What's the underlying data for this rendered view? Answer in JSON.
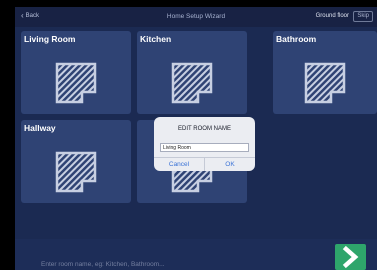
{
  "nav": {
    "back_label": "Back",
    "title": "Home Setup Wizard",
    "floor_label": "Ground floor",
    "skip_label": "Skip"
  },
  "rooms": [
    {
      "name": "Living Room",
      "icon": "floor-plan-icon"
    },
    {
      "name": "Kitchen",
      "icon": "floor-plan-icon"
    },
    {
      "name": "Bathroom",
      "icon": "floor-plan-icon"
    },
    {
      "name": "Hallway",
      "icon": "floor-plan-icon"
    },
    {
      "name": "",
      "icon": "floor-plan-icon"
    }
  ],
  "dialog": {
    "title": "EDIT ROOM NAME",
    "input_value": "Living Room",
    "cancel_label": "Cancel",
    "ok_label": "OK"
  },
  "bottom": {
    "placeholder": "Enter room name, eg: Kitchen, Bathroom...",
    "next_icon": "chevron-right-icon"
  },
  "colors": {
    "background": "#1b2a52",
    "card": "#2f4374",
    "accent_green": "#2ea56b",
    "link_blue": "#3a72d6"
  }
}
